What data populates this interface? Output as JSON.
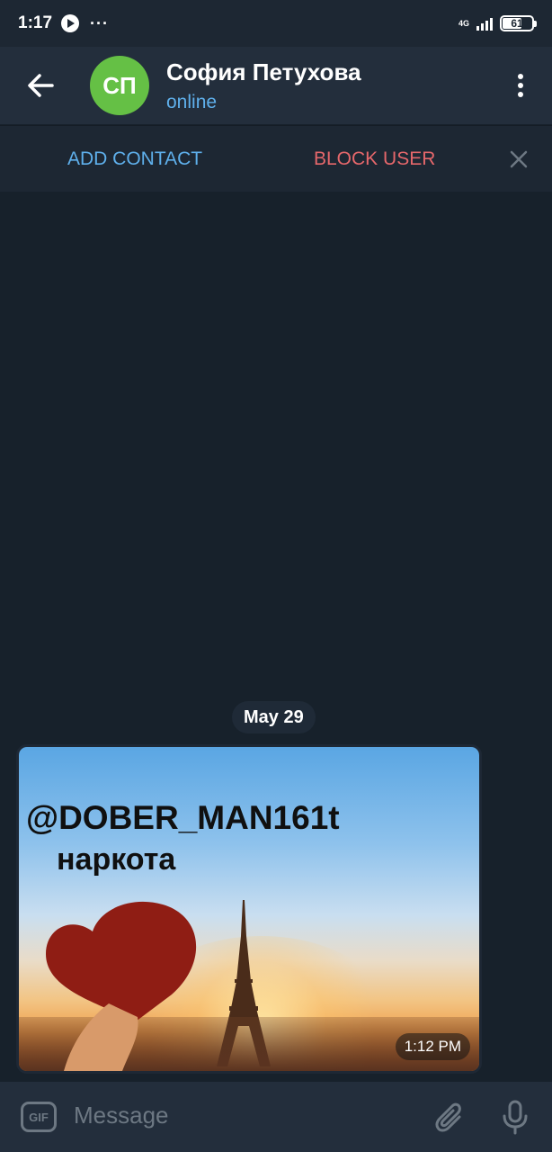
{
  "status_bar": {
    "time": "1:17",
    "more": "···",
    "network": "4G",
    "battery": "61"
  },
  "header": {
    "avatar_initials": "СП",
    "name": "София Петухова",
    "status": "online"
  },
  "action_bar": {
    "add_contact": "ADD CONTACT",
    "block_user": "BLOCK USER"
  },
  "chat": {
    "date": "May 29",
    "message": {
      "image_text_line1": "@DOBER_MAN161t",
      "image_text_line2": "наркота",
      "time": "1:12 PM"
    }
  },
  "composer": {
    "gif_label": "GIF",
    "placeholder": "Message"
  },
  "colors": {
    "background": "#17212b",
    "header": "#232e3c",
    "accent_blue": "#5fb0ec",
    "danger_red": "#e5676b",
    "avatar_green": "#65c045"
  },
  "icons": [
    "play-icon",
    "signal-icon",
    "battery-icon",
    "back-arrow-icon",
    "more-vertical-icon",
    "close-icon",
    "gif-icon",
    "attach-icon",
    "mic-icon"
  ]
}
